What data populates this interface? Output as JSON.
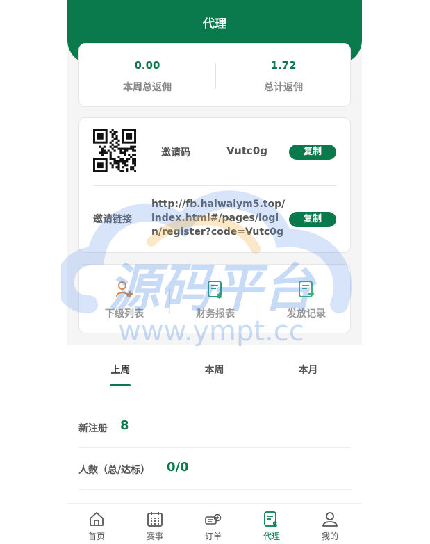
{
  "header": {
    "title": "代理"
  },
  "stats": [
    {
      "value": "0.00",
      "label": "本周总返佣"
    },
    {
      "value": "1.72",
      "label": "总计返佣"
    }
  ],
  "invite": {
    "code_label": "邀请码",
    "code": "Vutc0g",
    "copy_label": "复制",
    "link_label": "邀请链接",
    "link": "http://fb.haiwaiym5.top/index.html#/pages/login/register?code=Vutc0g",
    "link_copy_label": "复制"
  },
  "menu": [
    {
      "label": "下级列表",
      "icon": "team-icon"
    },
    {
      "label": "财务报表",
      "icon": "finance-report-icon"
    },
    {
      "label": "发放记录",
      "icon": "payout-record-icon"
    }
  ],
  "period_tabs": [
    {
      "label": "上周",
      "active": true
    },
    {
      "label": "本周",
      "active": false
    },
    {
      "label": "本月",
      "active": false
    }
  ],
  "metrics": [
    {
      "label": "新注册",
      "value": "8"
    },
    {
      "label": "人数（总/达标）",
      "value": "0/0"
    }
  ],
  "watermark": {
    "title": "源码平台",
    "url": "www.ympt.cc"
  },
  "nav": [
    {
      "label": "首页",
      "icon": "home-icon",
      "active": false
    },
    {
      "label": "赛事",
      "icon": "calendar-icon",
      "active": false
    },
    {
      "label": "订单",
      "icon": "ticket-icon",
      "active": false
    },
    {
      "label": "代理",
      "icon": "agent-report-icon",
      "active": true
    },
    {
      "label": "我的",
      "icon": "user-icon",
      "active": false
    }
  ],
  "colors": {
    "brand": "#0a7a4c",
    "accent_orange": "#e08a4a",
    "accent_teal": "#2a9a7a"
  }
}
